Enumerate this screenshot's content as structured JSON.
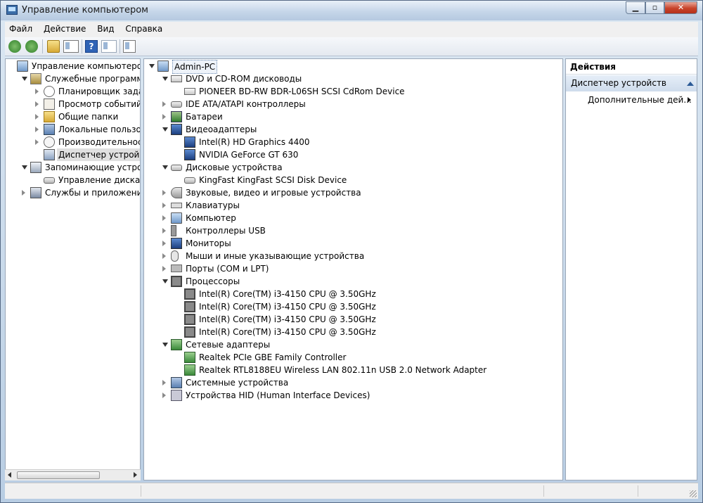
{
  "window": {
    "title": "Управление компьютером"
  },
  "menubar": {
    "items": [
      "Файл",
      "Действие",
      "Вид",
      "Справка"
    ]
  },
  "toolbar": {
    "buttons": [
      {
        "name": "back-arrow-icon"
      },
      {
        "name": "forward-arrow-icon"
      },
      {
        "name": "up-folder-icon"
      },
      {
        "name": "show-hide-console-tree-icon"
      },
      {
        "name": "help-icon",
        "glyph": "?"
      },
      {
        "name": "show-hide-action-pane-icon"
      },
      {
        "name": "scan-hardware-icon"
      }
    ]
  },
  "left_tree": {
    "items": [
      {
        "label": "Управление компьютером (л",
        "icon": "computer-management-icon",
        "expander": "none"
      },
      {
        "label": "Служебные программы",
        "icon": "tools-icon",
        "expander": "open"
      },
      {
        "label": "Планировщик заданий",
        "icon": "clock-icon",
        "expander": "closed"
      },
      {
        "label": "Просмотр событий",
        "icon": "event-log-icon",
        "expander": "closed"
      },
      {
        "label": "Общие папки",
        "icon": "shared-folder-icon",
        "expander": "closed"
      },
      {
        "label": "Локальные пользовате",
        "icon": "users-icon",
        "expander": "closed"
      },
      {
        "label": "Производительность",
        "icon": "performance-icon",
        "expander": "closed"
      },
      {
        "label": "Диспетчер устройств",
        "icon": "device-manager-icon",
        "expander": "none",
        "selected": true
      },
      {
        "label": "Запоминающие устройст",
        "icon": "storage-icon",
        "expander": "open"
      },
      {
        "label": "Управление дисками",
        "icon": "disk-management-icon",
        "expander": "none"
      },
      {
        "label": "Службы и приложения",
        "icon": "services-icon",
        "expander": "closed"
      }
    ]
  },
  "device_tree": {
    "root": "Admin-PC",
    "items": [
      {
        "label": "DVD и CD-ROM дисководы",
        "icon": "cdrom-icon",
        "expander": "open",
        "level": 1
      },
      {
        "label": "PIONEER BD-RW BDR-L06SH SCSI CdRom Device",
        "icon": "cdrom-icon",
        "expander": "none",
        "level": 2
      },
      {
        "label": "IDE ATA/ATAPI контроллеры",
        "icon": "ide-controller-icon",
        "expander": "closed",
        "level": 1
      },
      {
        "label": "Батареи",
        "icon": "battery-icon",
        "expander": "closed",
        "level": 1
      },
      {
        "label": "Видеоадаптеры",
        "icon": "display-adapter-icon",
        "expander": "open",
        "level": 1
      },
      {
        "label": "Intel(R) HD Graphics 4400",
        "icon": "display-adapter-icon",
        "expander": "none",
        "level": 2
      },
      {
        "label": "NVIDIA GeForce GT 630",
        "icon": "display-adapter-icon",
        "expander": "none",
        "level": 2
      },
      {
        "label": "Дисковые устройства",
        "icon": "disk-drive-icon",
        "expander": "open",
        "level": 1
      },
      {
        "label": "KingFast KingFast SCSI Disk Device",
        "icon": "disk-drive-icon",
        "expander": "none",
        "level": 2
      },
      {
        "label": "Звуковые, видео и игровые устройства",
        "icon": "sound-icon",
        "expander": "closed",
        "level": 1
      },
      {
        "label": "Клавиатуры",
        "icon": "keyboard-icon",
        "expander": "closed",
        "level": 1
      },
      {
        "label": "Компьютер",
        "icon": "computer-icon",
        "expander": "closed",
        "level": 1
      },
      {
        "label": "Контроллеры USB",
        "icon": "usb-icon",
        "expander": "closed",
        "level": 1
      },
      {
        "label": "Мониторы",
        "icon": "monitor-icon",
        "expander": "closed",
        "level": 1
      },
      {
        "label": "Мыши и иные указывающие устройства",
        "icon": "mouse-icon",
        "expander": "closed",
        "level": 1
      },
      {
        "label": "Порты (COM и LPT)",
        "icon": "port-icon",
        "expander": "closed",
        "level": 1
      },
      {
        "label": "Процессоры",
        "icon": "processor-icon",
        "expander": "open",
        "level": 1
      },
      {
        "label": "Intel(R) Core(TM) i3-4150 CPU @ 3.50GHz",
        "icon": "processor-icon",
        "expander": "none",
        "level": 2
      },
      {
        "label": "Intel(R) Core(TM) i3-4150 CPU @ 3.50GHz",
        "icon": "processor-icon",
        "expander": "none",
        "level": 2
      },
      {
        "label": "Intel(R) Core(TM) i3-4150 CPU @ 3.50GHz",
        "icon": "processor-icon",
        "expander": "none",
        "level": 2
      },
      {
        "label": "Intel(R) Core(TM) i3-4150 CPU @ 3.50GHz",
        "icon": "processor-icon",
        "expander": "none",
        "level": 2
      },
      {
        "label": "Сетевые адаптеры",
        "icon": "network-adapter-icon",
        "expander": "open",
        "level": 1
      },
      {
        "label": "Realtek PCIe GBE Family Controller",
        "icon": "network-adapter-icon",
        "expander": "none",
        "level": 2
      },
      {
        "label": "Realtek RTL8188EU Wireless LAN 802.11n USB 2.0 Network Adapter",
        "icon": "network-adapter-icon",
        "expander": "none",
        "level": 2
      },
      {
        "label": "Системные устройства",
        "icon": "system-device-icon",
        "expander": "closed",
        "level": 1
      },
      {
        "label": "Устройства HID (Human Interface Devices)",
        "icon": "hid-icon",
        "expander": "closed",
        "level": 1
      }
    ]
  },
  "actions": {
    "header": "Действия",
    "section": "Диспетчер устройств",
    "item": "Дополнительные дей..."
  }
}
